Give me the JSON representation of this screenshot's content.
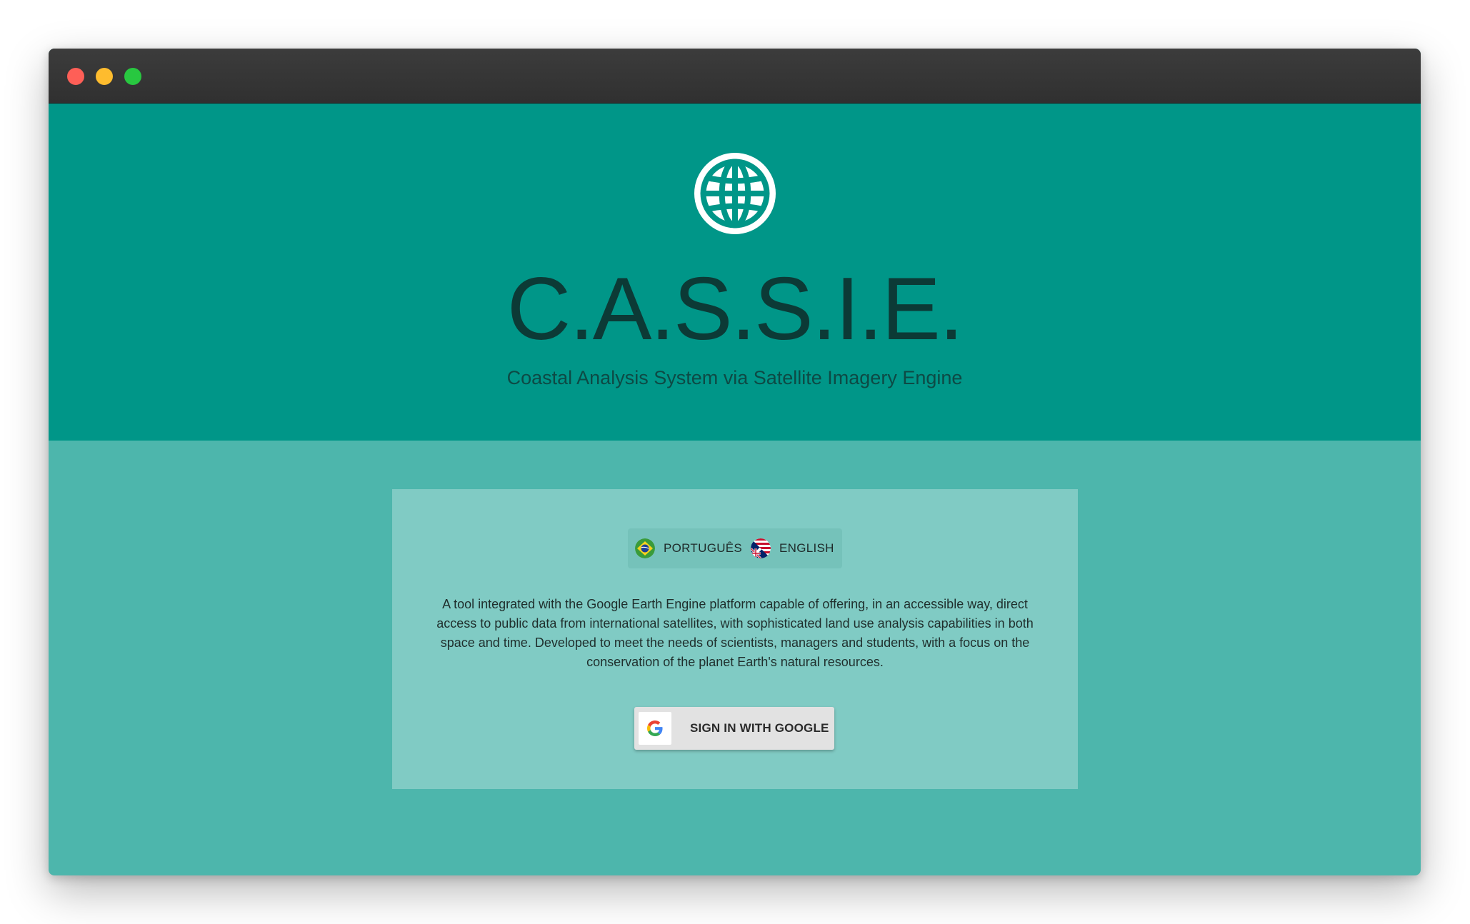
{
  "colors": {
    "hero_background": "#009688",
    "body_background": "#4db6ac",
    "card_background": "#80cbc4",
    "title_text": "#0c3a36"
  },
  "hero": {
    "icon": "globe-icon",
    "title": "C.A.S.S.I.E.",
    "subtitle": "Coastal Analysis System via Satellite Imagery Engine"
  },
  "languages": [
    {
      "label": "PORTUGUÊS",
      "icon": "brazil-flag-icon"
    },
    {
      "label": "ENGLISH",
      "icon": "uk-us-flag-icon"
    }
  ],
  "card": {
    "description": "A tool integrated with the Google Earth Engine platform capable of offering, in an accessible way, direct access to public data from international satellites, with sophisticated land use analysis capabilities in both space and time. Developed to meet the needs of scientists, managers and students, with a focus on the conservation of the planet Earth's natural resources.",
    "signin_label": "SIGN IN WITH GOOGLE",
    "signin_icon": "google-g-icon"
  }
}
